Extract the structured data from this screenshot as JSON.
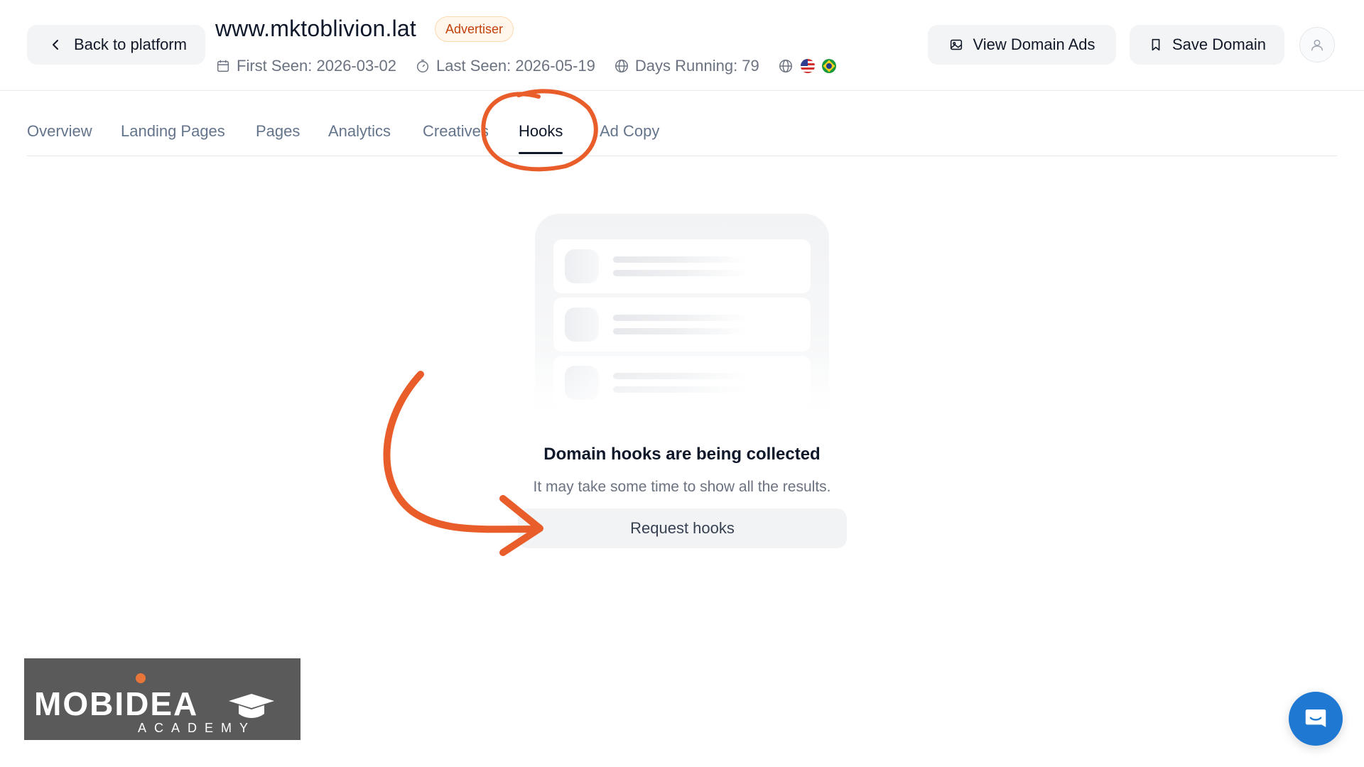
{
  "header": {
    "back_label": "Back to platform",
    "domain": "www.mktoblivion.lat",
    "badge": "Advertiser",
    "first_seen": "First Seen: 2026-03-02",
    "last_seen": "Last Seen: 2026-05-19",
    "days_running": "Days Running: 79",
    "view_ads_label": "View Domain Ads",
    "save_label": "Save Domain"
  },
  "tabs": [
    {
      "label": "Overview"
    },
    {
      "label": "Landing Pages"
    },
    {
      "label": "Pages"
    },
    {
      "label": "Analytics"
    },
    {
      "label": "Creatives"
    },
    {
      "label": "Hooks",
      "active": true
    },
    {
      "label": "Ad Copy"
    }
  ],
  "empty_state": {
    "title": "Domain hooks are being collected",
    "subtitle": "It may take some time to show all the results.",
    "button_label": "Request hooks"
  },
  "logo": {
    "name": "MOBIDEA",
    "tagline": "ACADEMY"
  },
  "colors": {
    "annotation": "#e85d2a",
    "chat": "#1f78d1",
    "badge_text": "#c2410c"
  },
  "icons": [
    "chevron-left-icon",
    "calendar-icon",
    "timer-icon",
    "globe-icon",
    "image-icon",
    "bookmark-icon",
    "user-icon",
    "chat-icon"
  ]
}
